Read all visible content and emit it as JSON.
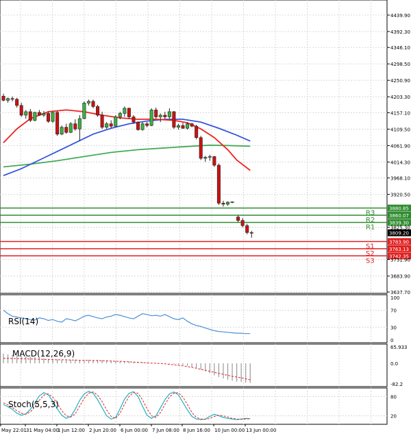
{
  "chart_data": {
    "type": "candlestick",
    "main": {
      "price_ticks": [
        "4439.90",
        "4392.30",
        "4346.10",
        "4298.50",
        "4250.90",
        "4203.30",
        "4157.10",
        "4109.50",
        "4061.90",
        "4014.30",
        "3968.10",
        "3920.50",
        "3825.30",
        "3731.90",
        "3683.90",
        "3637.70"
      ],
      "ylim": [
        3637.7,
        4439.9
      ],
      "current_price": "3809.20",
      "levels": [
        {
          "label": "R3",
          "value": 3880.85,
          "text": "3880.85",
          "color": "#2e8b2e"
        },
        {
          "label": "R2",
          "value": 3860.07,
          "text": "3860.07",
          "color": "#2e8b2e"
        },
        {
          "label": "R1",
          "value": 3839.3,
          "text": "3839.30",
          "color": "#2e8b2e"
        },
        {
          "label": "S1",
          "value": 3783.9,
          "text": "3783.90",
          "color": "#e02020"
        },
        {
          "label": "S2",
          "value": 3763.13,
          "text": "3763.13",
          "color": "#e02020"
        },
        {
          "label": "S3",
          "value": 3742.35,
          "text": "3742.35",
          "color": "#e02020"
        }
      ],
      "candles": [
        [
          4205,
          4212,
          4190,
          4193
        ],
        [
          4193,
          4201,
          4186,
          4198
        ],
        [
          4198,
          4204,
          4190,
          4196
        ],
        [
          4196,
          4200,
          4172,
          4178
        ],
        [
          4178,
          4186,
          4145,
          4150
        ],
        [
          4150,
          4165,
          4140,
          4160
        ],
        [
          4160,
          4168,
          4130,
          4135
        ],
        [
          4135,
          4160,
          4132,
          4158
        ],
        [
          4158,
          4165,
          4148,
          4150
        ],
        [
          4150,
          4162,
          4145,
          4155
        ],
        [
          4155,
          4160,
          4128,
          4132
        ],
        [
          4132,
          4160,
          4128,
          4158
        ],
        [
          4158,
          4162,
          4090,
          4095
        ],
        [
          4095,
          4120,
          4092,
          4115
        ],
        [
          4115,
          4125,
          4096,
          4100
        ],
        [
          4100,
          4130,
          4098,
          4125
        ],
        [
          4125,
          4138,
          4105,
          4110
        ],
        [
          4110,
          4150,
          4075,
          4140
        ],
        [
          4140,
          4190,
          4138,
          4185
        ],
        [
          4185,
          4195,
          4178,
          4190
        ],
        [
          4190,
          4195,
          4170,
          4175
        ],
        [
          4175,
          4180,
          4145,
          4150
        ],
        [
          4150,
          4160,
          4110,
          4115
        ],
        [
          4115,
          4130,
          4110,
          4125
        ],
        [
          4125,
          4135,
          4112,
          4118
        ],
        [
          4118,
          4150,
          4115,
          4145
        ],
        [
          4145,
          4160,
          4138,
          4155
        ],
        [
          4155,
          4175,
          4145,
          4170
        ],
        [
          4170,
          4172,
          4140,
          4145
        ],
        [
          4145,
          4150,
          4125,
          4130
        ],
        [
          4130,
          4132,
          4105,
          4108
        ],
        [
          4108,
          4130,
          4105,
          4125
        ],
        [
          4125,
          4130,
          4115,
          4120
        ],
        [
          4120,
          4170,
          4118,
          4165
        ],
        [
          4165,
          4172,
          4140,
          4145
        ],
        [
          4145,
          4155,
          4130,
          4150
        ],
        [
          4150,
          4160,
          4140,
          4145
        ],
        [
          4145,
          4170,
          4140,
          4160
        ],
        [
          4160,
          4162,
          4110,
          4115
        ],
        [
          4115,
          4125,
          4108,
          4120
        ],
        [
          4120,
          4128,
          4110,
          4112
        ],
        [
          4112,
          4130,
          4108,
          4125
        ],
        [
          4125,
          4128,
          4115,
          4118
        ],
        [
          4118,
          4122,
          4080,
          4085
        ],
        [
          4085,
          4090,
          4020,
          4025
        ],
        [
          4025,
          4032,
          4015,
          4028
        ],
        [
          4028,
          4035,
          4018,
          4030
        ],
        [
          4030,
          4032,
          4000,
          4005
        ],
        [
          4005,
          4010,
          3890,
          3895
        ],
        [
          3895,
          3902,
          3885,
          3892
        ],
        [
          3892,
          3900,
          3888,
          3898
        ],
        [
          3898,
          3900,
          3895,
          3899
        ],
        [
          3855,
          3860,
          3840,
          3845
        ],
        [
          3845,
          3852,
          3825,
          3830
        ],
        [
          3830,
          3835,
          3805,
          3810
        ],
        [
          3810,
          3815,
          3795,
          3809
        ]
      ],
      "ma_red": [
        [
          0,
          4070
        ],
        [
          3,
          4110
        ],
        [
          6,
          4140
        ],
        [
          10,
          4160
        ],
        [
          14,
          4165
        ],
        [
          18,
          4160
        ],
        [
          22,
          4150
        ],
        [
          26,
          4142
        ],
        [
          30,
          4138
        ],
        [
          34,
          4138
        ],
        [
          38,
          4135
        ],
        [
          41,
          4128
        ],
        [
          44,
          4110
        ],
        [
          47,
          4085
        ],
        [
          50,
          4050
        ],
        [
          52,
          4020
        ],
        [
          55,
          3990
        ]
      ],
      "ma_blue": [
        [
          0,
          3975
        ],
        [
          4,
          3995
        ],
        [
          8,
          4020
        ],
        [
          12,
          4045
        ],
        [
          16,
          4070
        ],
        [
          20,
          4095
        ],
        [
          24,
          4112
        ],
        [
          28,
          4125
        ],
        [
          32,
          4133
        ],
        [
          36,
          4138
        ],
        [
          40,
          4138
        ],
        [
          44,
          4130
        ],
        [
          48,
          4112
        ],
        [
          52,
          4092
        ],
        [
          55,
          4075
        ]
      ],
      "ma_green": [
        [
          0,
          4000
        ],
        [
          6,
          4008
        ],
        [
          12,
          4018
        ],
        [
          18,
          4030
        ],
        [
          24,
          4042
        ],
        [
          30,
          4050
        ],
        [
          36,
          4055
        ],
        [
          42,
          4060
        ],
        [
          46,
          4063
        ],
        [
          50,
          4062
        ],
        [
          55,
          4060
        ]
      ]
    },
    "rsi": {
      "label": "RSI(14)",
      "ticks": [
        "100",
        "70",
        "30",
        "0"
      ],
      "ylim": [
        0,
        100
      ],
      "values": [
        70,
        62,
        56,
        54,
        52,
        50,
        48,
        47,
        52,
        50,
        46,
        48,
        44,
        42,
        50,
        48,
        45,
        50,
        56,
        58,
        55,
        52,
        50,
        54,
        56,
        60,
        58,
        55,
        52,
        50,
        56,
        62,
        60,
        57,
        58,
        56,
        60,
        55,
        50,
        48,
        52,
        44,
        38,
        34,
        32,
        28,
        25,
        22,
        20,
        19,
        18,
        17,
        16,
        16,
        15,
        15
      ]
    },
    "macd": {
      "label": "MACD(12,26,9)",
      "ticks": [
        "65.933",
        "0.0",
        "-82.2"
      ],
      "ylim": [
        -82.2,
        65.933
      ],
      "histogram": [
        38,
        36,
        34,
        32,
        30,
        28,
        26,
        24,
        22,
        20,
        18,
        17,
        16,
        15,
        14,
        14,
        14,
        13,
        13,
        14,
        14,
        14,
        13,
        12,
        11,
        10,
        9,
        8,
        7,
        6,
        5,
        4,
        3,
        2,
        1,
        0,
        -1,
        -2,
        -3,
        -5,
        -7,
        -10,
        -14,
        -19,
        -25,
        -32,
        -40,
        -48,
        -55,
        -61,
        -66,
        -70,
        -73,
        -75,
        -77,
        -78
      ],
      "signal": [
        20,
        20,
        19,
        19,
        18,
        18,
        17,
        17,
        16,
        16,
        15,
        15,
        14,
        14,
        14,
        13,
        13,
        12,
        12,
        12,
        11,
        11,
        10,
        10,
        9,
        8,
        8,
        7,
        6,
        5,
        4,
        3,
        2,
        1,
        0,
        -1,
        -2,
        -4,
        -6,
        -8,
        -10,
        -13,
        -16,
        -20,
        -24,
        -28,
        -32,
        -36,
        -40,
        -44,
        -48,
        -52,
        -55,
        -58,
        -62,
        -66
      ]
    },
    "stoch": {
      "label": "Stoch(5,5,3)",
      "ticks": [
        "80",
        "20"
      ],
      "ylim": [
        0,
        100
      ],
      "main": [
        55,
        48,
        40,
        28,
        22,
        26,
        40,
        60,
        82,
        92,
        85,
        65,
        42,
        22,
        12,
        18,
        40,
        68,
        88,
        96,
        90,
        70,
        45,
        20,
        10,
        15,
        42,
        72,
        90,
        95,
        80,
        50,
        22,
        12,
        20,
        45,
        70,
        88,
        94,
        85,
        62,
        38,
        18,
        10,
        8,
        10,
        18,
        25,
        20,
        15,
        12,
        10,
        8,
        10,
        12,
        11
      ],
      "signal": [
        60,
        54,
        46,
        36,
        28,
        25,
        32,
        48,
        68,
        84,
        88,
        78,
        58,
        36,
        20,
        16,
        26,
        50,
        74,
        90,
        94,
        84,
        64,
        38,
        18,
        12,
        28,
        56,
        80,
        92,
        90,
        70,
        42,
        20,
        15,
        30,
        55,
        78,
        90,
        92,
        78,
        55,
        30,
        15,
        10,
        9,
        12,
        18,
        22,
        20,
        16,
        12,
        10,
        9,
        10,
        11
      ]
    },
    "x_labels": [
      "May 22:01",
      "31 May 04:00",
      "1 Jun 12:00",
      "2 Jun 20:00",
      "6 Jun 00:00",
      "7 Jun 08:00",
      "8 Jun 16:00",
      "10 Jun 00:00",
      "13 Jun 00:00"
    ],
    "colors": {
      "bull": "#3cb043",
      "bear": "#cc1111",
      "ma_red": "#ee2222",
      "ma_blue": "#3355dd",
      "ma_green": "#44aa55",
      "rsi_line": "#4a90d9",
      "grid": "#d8d8d8",
      "axis": "#000000"
    }
  }
}
